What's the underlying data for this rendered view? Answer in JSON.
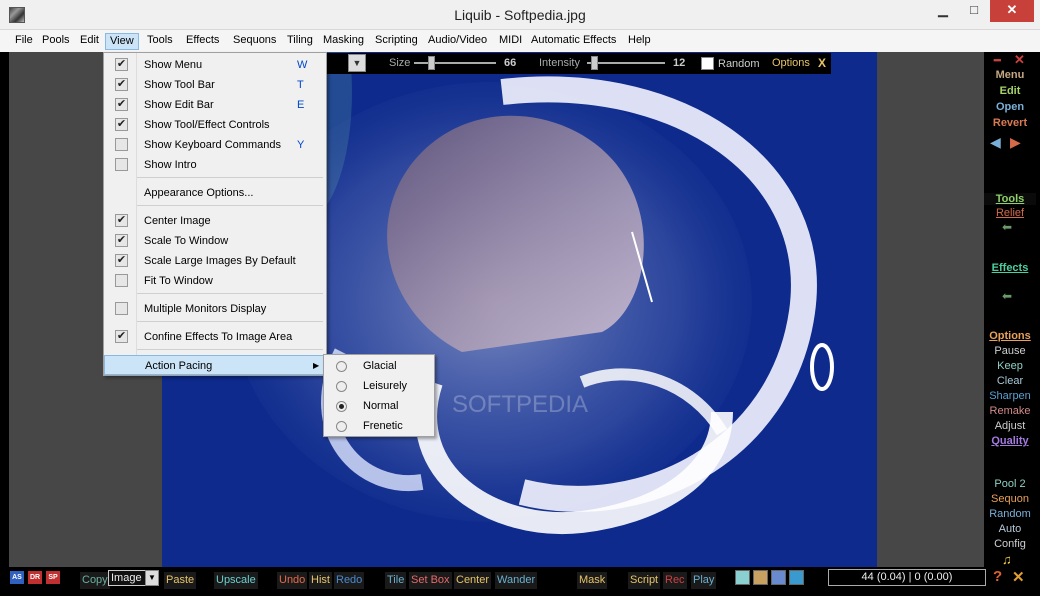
{
  "window": {
    "title": "Liquib - Softpedia.jpg",
    "controls": {
      "minimize": "▁",
      "maximize": "□",
      "close": "✕"
    }
  },
  "menu": {
    "items": [
      "File",
      "Pools",
      "Edit",
      "View",
      "Tools",
      "Effects",
      "Sequons",
      "Tiling",
      "Masking",
      "Scripting",
      "Audio/Video",
      "MIDI",
      "Automatic Effects",
      "Help"
    ],
    "active": "View"
  },
  "view_menu": {
    "items": [
      {
        "label": "Show Menu",
        "checked": true,
        "shortcut": "W"
      },
      {
        "label": "Show Tool Bar",
        "checked": true,
        "shortcut": "T"
      },
      {
        "label": "Show Edit Bar",
        "checked": true,
        "shortcut": "E"
      },
      {
        "label": "Show Tool/Effect Controls",
        "checked": true,
        "shortcut": ""
      },
      {
        "label": "Show Keyboard Commands",
        "checked": false,
        "shortcut": "Y"
      },
      {
        "label": "Show Intro",
        "checked": false,
        "shortcut": ""
      },
      {
        "label": "Appearance Options...",
        "checked": null,
        "shortcut": ""
      },
      {
        "label": "Center Image",
        "checked": true,
        "shortcut": ""
      },
      {
        "label": "Scale To Window",
        "checked": true,
        "shortcut": ""
      },
      {
        "label": "Scale Large Images By Default",
        "checked": true,
        "shortcut": ""
      },
      {
        "label": "Fit To Window",
        "checked": false,
        "shortcut": ""
      },
      {
        "label": "Multiple Monitors Display",
        "checked": false,
        "shortcut": ""
      },
      {
        "label": "Confine Effects To Image Area",
        "checked": true,
        "shortcut": ""
      },
      {
        "label": "Action Pacing",
        "checked": null,
        "shortcut": "",
        "submenu": true
      }
    ]
  },
  "pacing_submenu": {
    "items": [
      "Glacial",
      "Leisurely",
      "Normal",
      "Frenetic"
    ],
    "selected": "Normal"
  },
  "controls": {
    "size_label": "Size",
    "size_value": "66",
    "size_level": 0.1,
    "intensity_label": "Intensity",
    "intensity_value": "12",
    "intensity_level": 0.05,
    "random_label": "Random",
    "options_label": "Options",
    "close_label": "X"
  },
  "right_panel": {
    "top": [
      {
        "label": "Menu",
        "color": "#c4a882"
      },
      {
        "label": "Edit",
        "color": "#a6d46a"
      },
      {
        "label": "Open",
        "color": "#7ab0d8"
      },
      {
        "label": "Revert",
        "color": "#d97a55"
      }
    ],
    "tools_label": "Tools",
    "relief_label": "Relief",
    "effects_label": "Effects",
    "options_group": [
      {
        "label": "Options",
        "color": "#e8a05a",
        "underline": true
      },
      {
        "label": "Pause",
        "color": "#cfcfcf",
        "underline": false
      },
      {
        "label": "Keep",
        "color": "#8fd0c4",
        "underline": false
      },
      {
        "label": "Clear",
        "color": "#a8c8d8",
        "underline": false
      },
      {
        "label": "Sharpen",
        "color": "#5aa0d0",
        "underline": false
      },
      {
        "label": "Remake",
        "color": "#d48a8a",
        "underline": false
      },
      {
        "label": "Adjust",
        "color": "#cfcfcf",
        "underline": false
      },
      {
        "label": "Quality",
        "color": "#a37ae0",
        "underline": true
      }
    ],
    "pool_group": [
      {
        "label": "Pool 2",
        "color": "#8fd0c4"
      },
      {
        "label": "Sequon",
        "color": "#e8a05a"
      },
      {
        "label": "Random",
        "color": "#7ab0d8"
      },
      {
        "label": "Auto",
        "color": "#b8c8d8"
      },
      {
        "label": "Config",
        "color": "#cfcfcf"
      }
    ]
  },
  "bottom": {
    "copy": "Copy",
    "image": "Image",
    "paste": "Paste",
    "upscale": "Upscale",
    "undo": "Undo",
    "hist": "Hist",
    "redo": "Redo",
    "tile": "Tile",
    "setbox": "Set Box",
    "center": "Center",
    "wander": "Wander",
    "mask": "Mask",
    "script": "Script",
    "rec": "Rec",
    "play": "Play",
    "status": "44 (0.04) | 0 (0.00)",
    "badges": [
      "AS",
      "DR",
      "SP"
    ],
    "help": "?"
  },
  "colors": {
    "image_bg": "#0d2a8c",
    "shortcut": "#0047c8",
    "canvas_gray": "#474747"
  }
}
